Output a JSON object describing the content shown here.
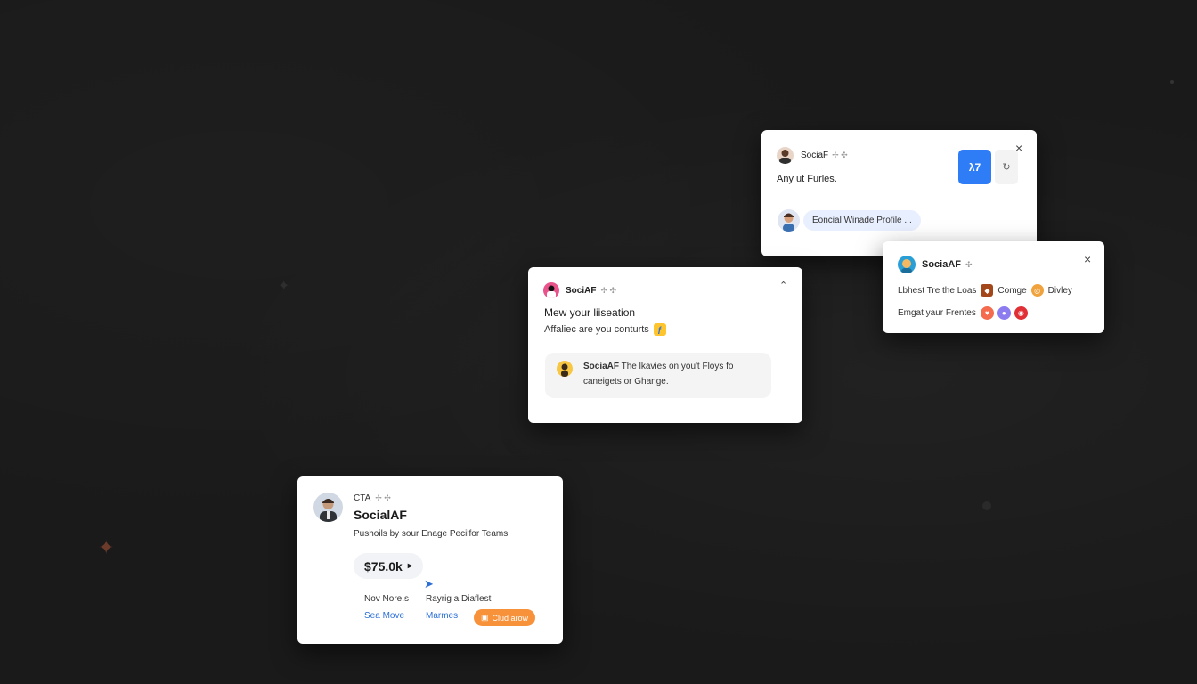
{
  "card_top": {
    "brand": "SociaF",
    "title": "Any ut Furles.",
    "chip_text": "Eoncial Winade Profile ...",
    "action_label": "λ7",
    "side_icon": "refresh-icon",
    "accent": "#2f7df6"
  },
  "card_right": {
    "brand": "SociaAF",
    "line1_text": "Lbhest Tre the Loas",
    "line1_item2": "Comge",
    "line1_item3": "Divley",
    "line2_text": "Emgat yaur Frentes"
  },
  "card_middle": {
    "brand": "SociAF",
    "heading": "Mew your liiseation",
    "subheading": "Affaliec are you conturts",
    "message_brand": "SociaAF",
    "message_rest": "The lkavies on you't Floys fo",
    "message_line2": "caneigets or Ghange."
  },
  "card_bottom": {
    "tag": "CTA",
    "brand": "SocialAF",
    "subtitle": "Pushoils by sour Enage Pecilfor Teams",
    "amount": "$75.0k",
    "col1_label": "Nov Nore.s",
    "col2_label": "Rayrig a Diaflest",
    "link1": "Sea Move",
    "link2": "Marmes",
    "cta_label": "Clud arow",
    "cta_color": "#f7923b"
  }
}
